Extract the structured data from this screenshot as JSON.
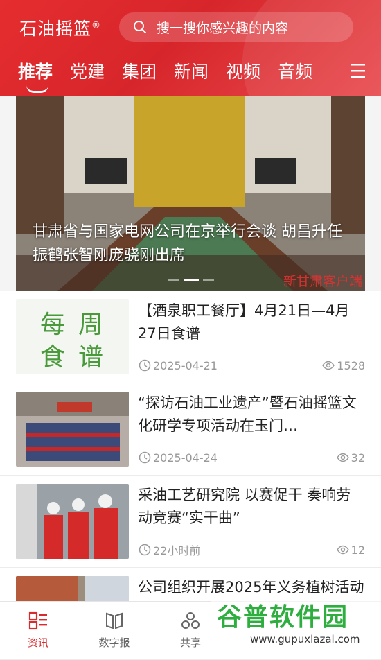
{
  "app": {
    "logo": "石油摇篮",
    "logo_mark": "®"
  },
  "search": {
    "placeholder": "搜一搜你感兴趣的内容",
    "icon": "search-icon"
  },
  "tabs": [
    {
      "label": "推荐",
      "active": true
    },
    {
      "label": "党建"
    },
    {
      "label": "集团"
    },
    {
      "label": "新闻"
    },
    {
      "label": "视频"
    },
    {
      "label": "音频"
    }
  ],
  "banner": {
    "caption": "甘肃省与国家电网公司在京举行会谈 胡昌升任振鹤张智刚庞骁刚出席",
    "source_mark": "新甘肃客户端",
    "slides": 3,
    "active_slide": 2
  },
  "articles": [
    {
      "title": "【酒泉职工餐厅】4月21日—4月27日食谱",
      "date": "2025-04-21",
      "views": "1528",
      "thumb_text": [
        "每",
        "周",
        "食",
        "谱"
      ]
    },
    {
      "title": "“探访石油工业遗产”暨石油摇篮文化研学专项活动在玉门…",
      "date": "2025-04-24",
      "views": "32"
    },
    {
      "title": "采油工艺研究院  以赛促干 奏响劳动竞赛“实干曲”",
      "date": "22小时前",
      "views": "12"
    },
    {
      "title": "公司组织开展2025年义务植树活动",
      "date": "",
      "views": ""
    }
  ],
  "bottom_nav": [
    {
      "label": "资讯",
      "icon": "news-icon",
      "active": true
    },
    {
      "label": "数字报",
      "icon": "newspaper-icon"
    },
    {
      "label": "共享",
      "icon": "share-icon"
    },
    {
      "label": "",
      "icon": ""
    },
    {
      "label": "",
      "icon": ""
    }
  ],
  "watermark": {
    "text": "谷普软件园",
    "url": "www.gupuxlazal.com"
  },
  "colors": {
    "brand": "#d92b2e",
    "header": "#e52d2f"
  }
}
